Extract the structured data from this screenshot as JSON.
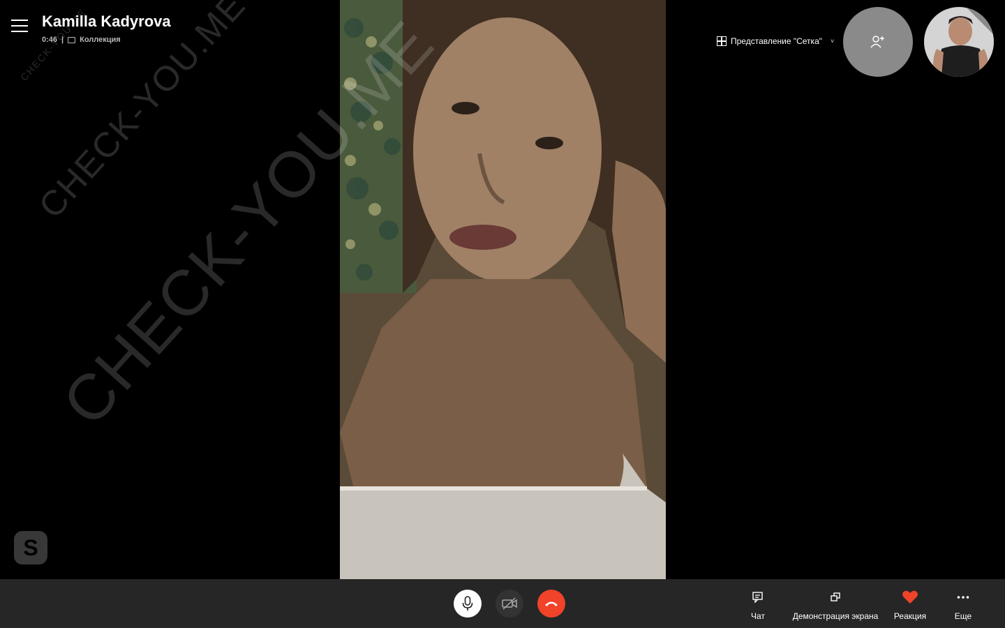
{
  "header": {
    "menu_icon": "hamburger-menu-icon",
    "caller_name": "Kamilla Kadyrova",
    "duration": "0:46",
    "separator": "|",
    "collection_icon": "collection-icon",
    "collection_label": "Коллекция"
  },
  "view": {
    "icon": "grid-icon",
    "label": "Представление \"Сетка\"",
    "chevron": "˅"
  },
  "add_participant": {
    "icon": "add-person-icon"
  },
  "watermark": {
    "text": "CHECK-YOU.ME"
  },
  "skype_logo": {
    "letter": "S"
  },
  "toolbar": {
    "mic_icon": "microphone-icon",
    "video_icon": "video-off-icon",
    "hangup_icon": "hang-up-icon",
    "hangup_color": "#f0432a",
    "chat_label": "Чат",
    "share_label": "Демонстрация экрана",
    "reaction_label": "Реакция",
    "reaction_color": "#f0432a",
    "more_label": "Еще"
  }
}
